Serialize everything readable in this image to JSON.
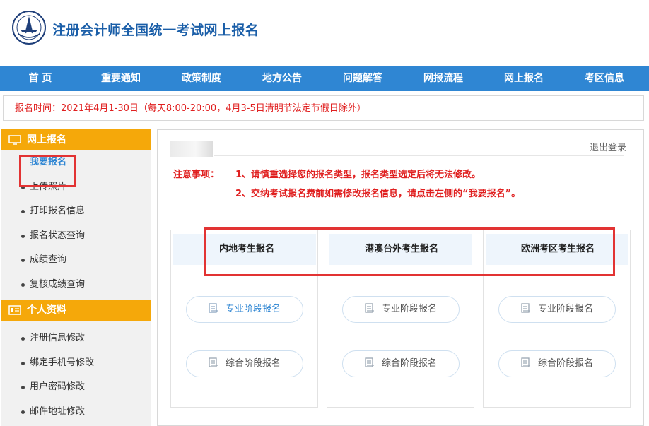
{
  "header": {
    "title": "注册会计师全国统一考试网上报名",
    "logo_icon": "cicpa-emblem-icon"
  },
  "nav": [
    "首 页",
    "重要通知",
    "政策制度",
    "地方公告",
    "问题解答",
    "网报流程",
    "网上报名",
    "考区信息"
  ],
  "notice": "报名时间：2021年4月1-30日（每天8:00-20:00，4月3-5日清明节法定节假日除外）",
  "sidebar": {
    "section1": {
      "title": "网上报名",
      "icon": "monitor-icon",
      "items": [
        "我要报名",
        "上传照片",
        "打印报名信息",
        "报名状态查询",
        "成绩查询",
        "复核成绩查询"
      ]
    },
    "section2": {
      "title": "个人资料",
      "icon": "id-card-icon",
      "items": [
        "注册信息修改",
        "绑定手机号修改",
        "用户密码修改",
        "邮件地址修改"
      ]
    }
  },
  "main": {
    "logout": "退出登录",
    "warn_label": "注意事项：",
    "warn_1": "1、请慎重选择您的报名类型，报名类型选定后将无法修改。",
    "warn_2": "2、交纳考试报名费前如需修改报名信息，请点击左侧的“我要报名”。",
    "columns": [
      {
        "title": "内地考生报名",
        "btn1": "专业阶段报名",
        "btn2": "综合阶段报名"
      },
      {
        "title": "港澳台外考生报名",
        "btn1": "专业阶段报名",
        "btn2": "综合阶段报名"
      },
      {
        "title": "欧洲考区考生报名",
        "btn1": "专业阶段报名",
        "btn2": "综合阶段报名"
      }
    ]
  },
  "colors": {
    "nav_bg": "#2f86d3",
    "sidebar_head": "#f5a80a",
    "warning": "#e02020",
    "highlight": "#e23333"
  }
}
